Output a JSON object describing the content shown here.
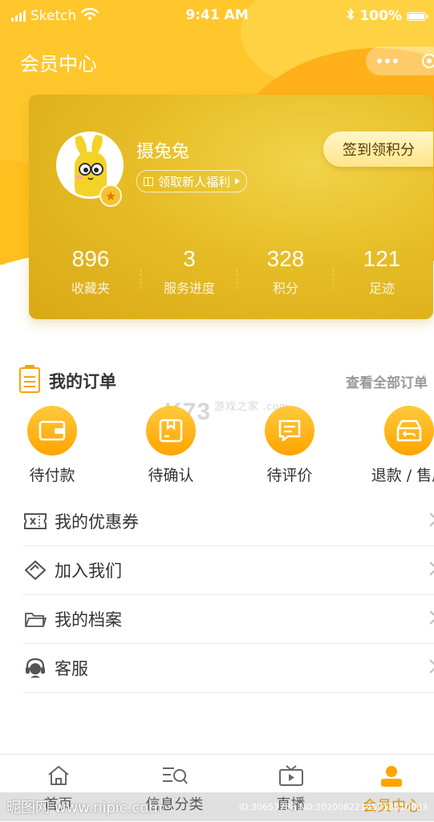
{
  "status_bar": {
    "carrier": "Sketch",
    "time": "9:41 AM",
    "battery": "100%"
  },
  "header": {
    "title": "会员中心"
  },
  "member_card": {
    "username": "摄兔兔",
    "welfare_label": "领取新人福利",
    "signin_label": "签到领积分",
    "stats": [
      {
        "value": "896",
        "label": "收藏夹"
      },
      {
        "value": "3",
        "label": "服务进度"
      },
      {
        "value": "328",
        "label": "积分"
      },
      {
        "value": "121",
        "label": "足迹"
      }
    ]
  },
  "orders": {
    "title": "我的订单",
    "view_all": "查看全部订单",
    "items": [
      {
        "label": "待付款",
        "icon": "wallet-icon"
      },
      {
        "label": "待确认",
        "icon": "package-icon"
      },
      {
        "label": "待评价",
        "icon": "comment-icon"
      },
      {
        "label": "退款 / 售后",
        "icon": "refund-box-icon"
      }
    ]
  },
  "menu": {
    "items": [
      {
        "label": "我的优惠券",
        "icon": "coupon-icon"
      },
      {
        "label": "加入我们",
        "icon": "handshake-icon"
      },
      {
        "label": "我的档案",
        "icon": "folder-icon"
      },
      {
        "label": "客服",
        "icon": "headset-icon"
      }
    ]
  },
  "tabbar": {
    "items": [
      {
        "label": "首页",
        "icon": "home-icon",
        "active": false
      },
      {
        "label": "信息分类",
        "icon": "category-search-icon",
        "active": false
      },
      {
        "label": "直播",
        "icon": "tv-icon",
        "active": false
      },
      {
        "label": "会员中心",
        "icon": "member-icon",
        "active": true
      }
    ]
  },
  "overlays": {
    "k73_watermark": "K73",
    "k73_sub": "游戏之家 .com",
    "nipic_left": "昵图网 www.nipic.com",
    "nipic_right": "ID:30653788 NO:20200822145718610083"
  },
  "colors": {
    "accent": "#ffa400",
    "header_bg": "#ffc72c",
    "card_gold": "#e6bd26",
    "text_primary": "#333333",
    "text_secondary": "#999999"
  }
}
